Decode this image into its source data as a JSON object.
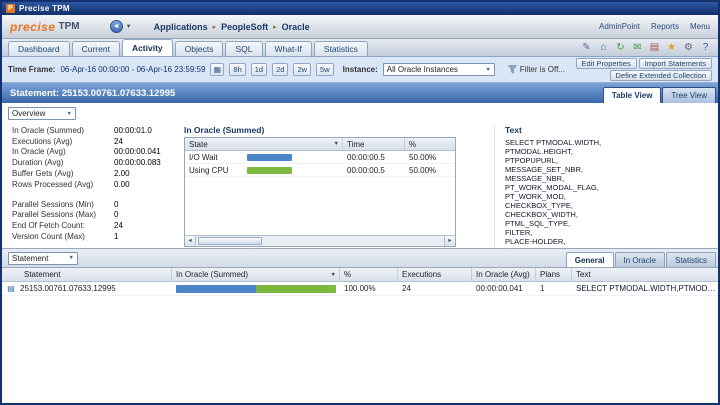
{
  "window": {
    "title": "Precise TPM"
  },
  "header": {
    "logo": "precise",
    "product": "TPM",
    "breadcrumb": [
      "Applications",
      "PeopleSoft",
      "Oracle"
    ],
    "links": [
      "AdminPoint",
      "Reports",
      "Menu"
    ]
  },
  "main_tabs": {
    "items": [
      "Dashboard",
      "Current",
      "Activity",
      "Objects",
      "SQL",
      "What-If",
      "Statistics"
    ],
    "active": "Activity"
  },
  "toolbar_icons": [
    {
      "name": "edit-icon",
      "glyph": "✎",
      "color": "#7a5aa0"
    },
    {
      "name": "home-icon",
      "glyph": "⌂",
      "color": "#3f6fae"
    },
    {
      "name": "refresh-icon",
      "glyph": "↻",
      "color": "#3f9e3f"
    },
    {
      "name": "mail-icon",
      "glyph": "✉",
      "color": "#3f9e3f"
    },
    {
      "name": "report-icon",
      "glyph": "▤",
      "color": "#b05050"
    },
    {
      "name": "favorite-icon",
      "glyph": "★",
      "color": "#e0a020"
    },
    {
      "name": "settings-icon",
      "glyph": "⚙",
      "color": "#5a6a7a"
    },
    {
      "name": "help-icon",
      "glyph": "?",
      "color": "#2f5fae"
    }
  ],
  "timebar": {
    "label": "Time Frame:",
    "range": "06-Apr-16 00:00:00 - 06-Apr-16 23:59:59",
    "presets": [
      "8h",
      "1d",
      "2d",
      "2w",
      "5w"
    ],
    "instance_label": "Instance:",
    "instance_value": "All Oracle Instances",
    "filter_label": "Filter is Off...",
    "actions": [
      "Edit Properties",
      "Import Statements",
      "Define Extended Collection"
    ]
  },
  "statement_header": {
    "title": "Statement: 25153.00761.07633.12995",
    "views": [
      "Table View",
      "Tree View"
    ],
    "active_view": "Table View"
  },
  "overview": {
    "selector": "Overview",
    "metrics_primary": [
      {
        "label": "In Oracle (Summed)",
        "value": "00:00:01.0"
      },
      {
        "label": "Executions (Avg)",
        "value": "24"
      },
      {
        "label": "In Oracle (Avg)",
        "value": "00:00:00.041"
      },
      {
        "label": "Duration (Avg)",
        "value": "00:00:00.083"
      },
      {
        "label": "Buffer Gets (Avg)",
        "value": "2.00"
      },
      {
        "label": "Rows Processed (Avg)",
        "value": "0.00"
      }
    ],
    "metrics_secondary": [
      {
        "label": "Parallel Sessions (Min)",
        "value": "0"
      },
      {
        "label": "Parallel Sessions (Max)",
        "value": "0"
      },
      {
        "label": "End Of Fetch Count:",
        "value": "24"
      },
      {
        "label": "Version Count (Max)",
        "value": "1"
      }
    ]
  },
  "in_oracle_panel": {
    "title": "In Oracle (Summed)",
    "columns": [
      "State",
      "Time",
      "%"
    ],
    "rows": [
      {
        "state": "I/O Wait",
        "time": "00:00:00.5",
        "pct": "50.00%",
        "pct_num": 50,
        "color": "#4a86c8"
      },
      {
        "state": "Using CPU",
        "time": "00:00:00.5",
        "pct": "50.00%",
        "pct_num": 50,
        "color": "#7cb93e"
      }
    ]
  },
  "text_panel": {
    "title": "Text",
    "sql": "SELECT PTMODAL.WIDTH,\nPTMODAL.HEIGHT,\nPTPOPUPURL,\nMESSAGE_SET_NBR,\nMESSAGE_NBR,\nPT_WORK_MODAL_FLAG,\nPT_WORK_MOD,\nCHECKBOX_TYPE,\nCHECKBOX_WIDTH,\nPTML_SQL_TYPE,\nFILTER,\nPLACE-HOLDER,\nD.H.MSG_SET_NBR"
  },
  "bottom": {
    "selector": "Statement",
    "tabs": [
      "General",
      "In Oracle",
      "Statistics"
    ],
    "active_tab": "General",
    "table": {
      "columns": [
        "Statement",
        "In Oracle (Summed)",
        "%",
        "Executions",
        "In Oracle (Avg)",
        "Plans",
        "Text"
      ],
      "rows": [
        {
          "statement": "25153.00761.07633.12995",
          "bar": [
            {
              "pct_num": 50,
              "color": "#4a86c8"
            },
            {
              "pct_num": 50,
              "color": "#7cb93e"
            }
          ],
          "pct": "100.00%",
          "executions": "24",
          "in_oracle_avg": "00:00:00.041",
          "plans": "1",
          "text": "SELECT PTMODAL.WIDTH,PTMODAL.HEIGHT,PTPOPUPURL,..."
        }
      ]
    }
  },
  "icons": {
    "back": "◄",
    "dropdown": "▼",
    "breadcrumb_sep": "▸",
    "calendar": "▦",
    "sort": "▼",
    "select_arrow": "▼",
    "scroll_left": "◄",
    "scroll_right": "►",
    "row_doc": "▤"
  },
  "colors": {
    "accent_orange": "#e87722",
    "bar_blue": "#4a86c8",
    "bar_green": "#7cb93e",
    "header_blue": "#3a69a8",
    "titlebar_blue": "#10306b"
  }
}
